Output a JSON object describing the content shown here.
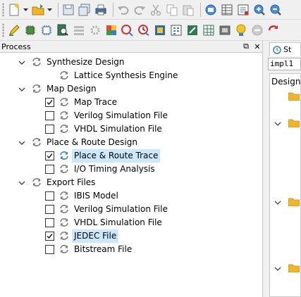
{
  "toolbar1": {
    "icons": [
      "new-file-icon",
      "dropdown-arrow-icon",
      "open-folder-icon",
      "dropdown-arrow-icon",
      "save-icon",
      "save-all-icon",
      "print-icon",
      "undo-icon",
      "redo-icon",
      "cut-icon",
      "copy-icon",
      "paste-icon",
      "properties-icon",
      "table-icon",
      "report-icon",
      "zoom-in-icon",
      "zoom-out-icon"
    ]
  },
  "toolbar2": {
    "icons": [
      "edit-icon",
      "chip-icon",
      "chip-outline-icon",
      "search-doc-icon",
      "layers-icon",
      "gear-chip-icon",
      "grid-color-icon",
      "route-icon",
      "timing-icon",
      "display-icon",
      "bits-icon",
      "fit-icon",
      "spreadsheet-icon",
      "power-icon",
      "bulb-icon",
      "no-entry-icon",
      "refresh-red-icon"
    ]
  },
  "process": {
    "title": "Process",
    "float_btn": "⧉",
    "close_btn": "✕",
    "groups": [
      {
        "label": "Synthesize Design",
        "items": [
          {
            "label": "Lattice Synthesis Engine",
            "checkbox": false
          }
        ]
      },
      {
        "label": "Map Design",
        "items": [
          {
            "label": "Map Trace",
            "checkbox": true,
            "checked": true
          },
          {
            "label": "Verilog Simulation File",
            "checkbox": true,
            "checked": false
          },
          {
            "label": "VHDL Simulation File",
            "checkbox": true,
            "checked": false
          }
        ]
      },
      {
        "label": "Place & Route Design",
        "items": [
          {
            "label": "Place & Route Trace",
            "checkbox": true,
            "checked": true,
            "selected": true
          },
          {
            "label": "I/O Timing Analysis",
            "checkbox": true,
            "checked": false
          }
        ]
      },
      {
        "label": "Export Files",
        "items": [
          {
            "label": "IBIS Model",
            "checkbox": true,
            "checked": false
          },
          {
            "label": "Verilog Simulation File",
            "checkbox": true,
            "checked": false
          },
          {
            "label": "VHDL Simulation File",
            "checkbox": true,
            "checked": false
          },
          {
            "label": "JEDEC File",
            "checkbox": true,
            "checked": true,
            "selected": true
          },
          {
            "label": "Bitstream File",
            "checkbox": true,
            "checked": false
          }
        ]
      }
    ]
  },
  "right": {
    "tab_label": "St",
    "impl_value": "impl1",
    "tree_header": "Design"
  },
  "colors": {
    "run_icon": "#7c7c7c",
    "run_icon_selected": "#3a80c8",
    "selection_bg": "#cce8ff",
    "folder": "#f0b429"
  }
}
